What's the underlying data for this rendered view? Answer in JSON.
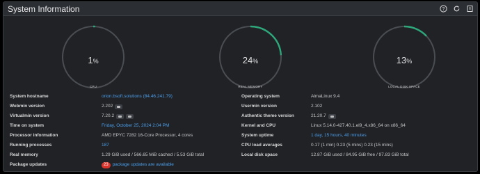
{
  "panel": {
    "title": "System Information"
  },
  "header_icons": [
    "help-icon",
    "refresh-icon",
    "collapse-icon"
  ],
  "gauges": [
    {
      "value": "1",
      "unit": "%",
      "label": "CPU",
      "fraction": 0.01
    },
    {
      "value": "24",
      "unit": "%",
      "label": "REAL MEMORY",
      "fraction": 0.24
    },
    {
      "value": "13",
      "unit": "%",
      "label": "LOCAL DISK SPACE",
      "fraction": 0.13
    }
  ],
  "colors": {
    "accent": "#2ea87b",
    "track": "#4a4d52",
    "link": "#4d9ee8",
    "badge": "#d9342b"
  },
  "left_rows": [
    {
      "label": "System hostname",
      "value": "orion.bsoft.solutions (84.46.241.79)",
      "link": true,
      "button": false
    },
    {
      "label": "Webmin version",
      "value": "2.202",
      "link": false,
      "button": true
    },
    {
      "label": "Virtualmin version",
      "value": "7.20.2",
      "link": false,
      "button": true
    },
    {
      "label": "Time on system",
      "value": "Friday, October 25, 2024 2:04 PM",
      "link": true,
      "button": false
    },
    {
      "label": "Processor information",
      "value": "AMD EPYC 7282 16-Core Processor, 4 cores",
      "link": false,
      "button": false
    },
    {
      "label": "Running processes",
      "value": "187",
      "link": true,
      "button": false
    },
    {
      "label": "Real memory",
      "value": "1.29 GiB used / 566.65 MiB cached / 5.53 GiB total",
      "link": false,
      "button": false
    },
    {
      "label": "Package updates",
      "value": "package updates are available",
      "badge": "23",
      "link": true,
      "button": false
    }
  ],
  "right_rows": [
    {
      "label": "Operating system",
      "value": "AlmaLinux 9.4",
      "link": false,
      "button": false
    },
    {
      "label": "Usermin version",
      "value": "2.102",
      "link": false,
      "button": false
    },
    {
      "label": "Authentic theme version",
      "value": "21.20.7",
      "link": false,
      "button": true
    },
    {
      "label": "Kernel and CPU",
      "value": "Linux 5.14.0-427.40.1.el9_4.x86_64 on x86_64",
      "link": false,
      "button": false
    },
    {
      "label": "System uptime",
      "value": "1 day, 15 hours, 40 minutes",
      "link": true,
      "button": false
    },
    {
      "label": "CPU load averages",
      "value": "0.17 (1 min) 0.23 (5 mins) 0.23 (15 mins)",
      "link": false,
      "button": false
    },
    {
      "label": "Local disk space",
      "value": "12.87 GiB used / 84.95 GiB free / 97.83 GiB total",
      "link": false,
      "button": false
    }
  ]
}
